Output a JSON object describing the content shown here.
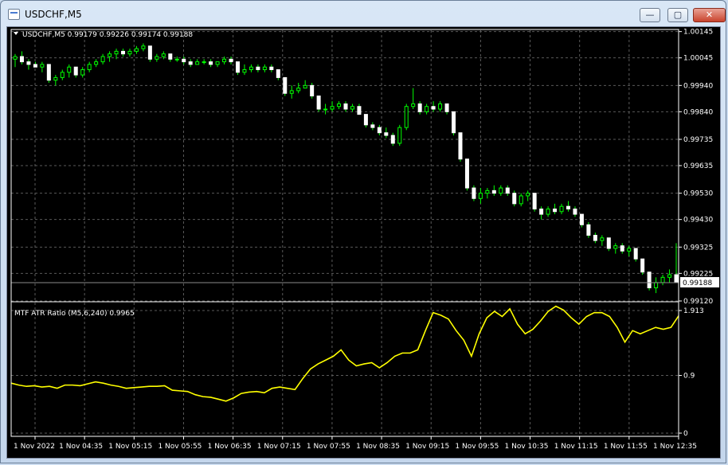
{
  "window": {
    "title": "USDCHF,M5",
    "buttons": {
      "minimize": "—",
      "maximize": "▢",
      "close": "✕"
    }
  },
  "main_chart": {
    "header": "USDCHF,M5  0.99179 0.99226 0.99174 0.99188",
    "current_price": "0.99188",
    "price_scale": [
      "1.00145",
      "1.00045",
      "0.99940",
      "0.99840",
      "0.99735",
      "0.99635",
      "0.99530",
      "0.99430",
      "0.99325",
      "0.99225",
      "0.99120"
    ]
  },
  "indicator": {
    "label": "MTF ATR Ratio  (M5,6,240) 0.9965",
    "scale": [
      "1.913",
      "0.9",
      "0"
    ]
  },
  "time_axis": [
    "1 Nov 2022",
    "1 Nov 04:35",
    "1 Nov 05:15",
    "1 Nov 05:55",
    "1 Nov 06:35",
    "1 Nov 07:15",
    "1 Nov 07:55",
    "1 Nov 08:35",
    "1 Nov 09:15",
    "1 Nov 09:55",
    "1 Nov 10:35",
    "1 Nov 11:15",
    "1 Nov 11:55",
    "1 Nov 12:35"
  ],
  "colors": {
    "bull": "#00ff00",
    "bear": "#ffffff",
    "grid": "#5a5a5a",
    "indicator_line": "#ffff00",
    "axis_text": "#ffffff"
  },
  "chart_data": [
    {
      "type": "candlestick",
      "title": "USDCHF,M5",
      "ylim": [
        0.9912,
        1.0015
      ],
      "ohlc": [
        [
          1.0004,
          1.0006,
          1.0001,
          1.0005
        ],
        [
          1.0005,
          1.0007,
          1.0002,
          1.0003
        ],
        [
          1.0003,
          1.0004,
          1.0,
          1.0002
        ],
        [
          1.0002,
          1.0003,
          1.0001,
          1.0001
        ],
        [
          1.0001,
          1.0003,
          0.9999,
          1.0002
        ],
        [
          1.0002,
          1.0002,
          0.9995,
          0.9996
        ],
        [
          0.9996,
          0.9998,
          0.9994,
          0.9997
        ],
        [
          0.9997,
          1.0,
          0.9996,
          0.9999
        ],
        [
          0.9999,
          1.0002,
          0.9997,
          1.0001
        ],
        [
          1.0001,
          1.0001,
          0.9997,
          0.9998
        ],
        [
          0.9998,
          1.0001,
          0.9997,
          1.0
        ],
        [
          1.0,
          1.0003,
          0.9999,
          1.0002
        ],
        [
          1.0002,
          1.0004,
          1.0001,
          1.0003
        ],
        [
          1.0003,
          1.0006,
          1.0002,
          1.0005
        ],
        [
          1.0005,
          1.0007,
          1.0003,
          1.0006
        ],
        [
          1.0006,
          1.0008,
          1.0004,
          1.0007
        ],
        [
          1.0007,
          1.0008,
          1.0005,
          1.0006
        ],
        [
          1.0006,
          1.0008,
          1.0005,
          1.0007
        ],
        [
          1.0007,
          1.0009,
          1.0006,
          1.0008
        ],
        [
          1.0008,
          1.001,
          1.0007,
          1.0009
        ],
        [
          1.0009,
          1.0009,
          1.0003,
          1.0004
        ],
        [
          1.0004,
          1.0006,
          1.0003,
          1.0005
        ],
        [
          1.0005,
          1.0007,
          1.0004,
          1.0006
        ],
        [
          1.0006,
          1.0006,
          1.0003,
          1.0004
        ],
        [
          1.0004,
          1.0005,
          1.0003,
          1.0004
        ],
        [
          1.0004,
          1.0005,
          1.0002,
          1.0003
        ],
        [
          1.0003,
          1.0004,
          1.0001,
          1.0002
        ],
        [
          1.0002,
          1.0004,
          1.0002,
          1.0003
        ],
        [
          1.0003,
          1.0004,
          1.0002,
          1.0003
        ],
        [
          1.0003,
          1.0004,
          1.0001,
          1.0002
        ],
        [
          1.0002,
          1.0003,
          1.0001,
          1.0003
        ],
        [
          1.0003,
          1.0005,
          1.0002,
          1.0004
        ],
        [
          1.0004,
          1.0005,
          1.0002,
          1.0003
        ],
        [
          1.0003,
          1.0003,
          0.9998,
          0.9999
        ],
        [
          0.9999,
          1.0002,
          0.9998,
          1.0
        ],
        [
          1.0,
          1.0002,
          0.9999,
          1.0001
        ],
        [
          1.0001,
          1.0002,
          0.9999,
          1.0
        ],
        [
          1.0,
          1.0002,
          0.9999,
          1.0001
        ],
        [
          1.0001,
          1.0002,
          0.9999,
          1.0
        ],
        [
          1.0,
          1.0,
          0.9996,
          0.9997
        ],
        [
          0.9997,
          0.9997,
          0.999,
          0.9991
        ],
        [
          0.9991,
          0.9994,
          0.9989,
          0.9992
        ],
        [
          0.9992,
          0.9995,
          0.9991,
          0.9993
        ],
        [
          0.9993,
          0.9996,
          0.9993,
          0.9994
        ],
        [
          0.9994,
          0.9995,
          0.9989,
          0.999
        ],
        [
          0.999,
          0.999,
          0.9984,
          0.9985
        ],
        [
          0.9985,
          0.9987,
          0.9983,
          0.9985
        ],
        [
          0.9985,
          0.9988,
          0.9984,
          0.9986
        ],
        [
          0.9986,
          0.9988,
          0.9985,
          0.9987
        ],
        [
          0.9987,
          0.9988,
          0.9984,
          0.9985
        ],
        [
          0.9985,
          0.9987,
          0.9984,
          0.9986
        ],
        [
          0.9986,
          0.9987,
          0.9983,
          0.9983
        ],
        [
          0.9983,
          0.9983,
          0.9978,
          0.9979
        ],
        [
          0.9979,
          0.998,
          0.9977,
          0.9978
        ],
        [
          0.9978,
          0.9979,
          0.9975,
          0.9976
        ],
        [
          0.9976,
          0.9978,
          0.9974,
          0.9975
        ],
        [
          0.9975,
          0.9976,
          0.9971,
          0.9972
        ],
        [
          0.9972,
          0.9979,
          0.9971,
          0.9978
        ],
        [
          0.9978,
          0.9987,
          0.9977,
          0.9986
        ],
        [
          0.9986,
          0.9993,
          0.9985,
          0.9987
        ],
        [
          0.9987,
          0.9988,
          0.9983,
          0.9984
        ],
        [
          0.9984,
          0.9987,
          0.9983,
          0.9986
        ],
        [
          0.9986,
          0.9988,
          0.9984,
          0.9985
        ],
        [
          0.9985,
          0.9988,
          0.9984,
          0.9987
        ],
        [
          0.9987,
          0.9987,
          0.9983,
          0.9984
        ],
        [
          0.9984,
          0.9984,
          0.9975,
          0.9976
        ],
        [
          0.9976,
          0.9976,
          0.9965,
          0.9966
        ],
        [
          0.9966,
          0.9966,
          0.9954,
          0.9955
        ],
        [
          0.9955,
          0.9956,
          0.995,
          0.9951
        ],
        [
          0.9951,
          0.9955,
          0.9949,
          0.9953
        ],
        [
          0.9953,
          0.9955,
          0.9951,
          0.9954
        ],
        [
          0.9954,
          0.9956,
          0.9952,
          0.9953
        ],
        [
          0.9953,
          0.9956,
          0.9952,
          0.9955
        ],
        [
          0.9955,
          0.9956,
          0.9952,
          0.9953
        ],
        [
          0.9953,
          0.9954,
          0.9948,
          0.9949
        ],
        [
          0.9949,
          0.9953,
          0.9948,
          0.9952
        ],
        [
          0.9952,
          0.9954,
          0.995,
          0.9953
        ],
        [
          0.9953,
          0.9953,
          0.9946,
          0.9947
        ],
        [
          0.9947,
          0.9948,
          0.9943,
          0.9945
        ],
        [
          0.9945,
          0.9948,
          0.9944,
          0.9947
        ],
        [
          0.9947,
          0.9949,
          0.9945,
          0.9946
        ],
        [
          0.9946,
          0.9949,
          0.9945,
          0.9948
        ],
        [
          0.9948,
          0.995,
          0.9946,
          0.9947
        ],
        [
          0.9947,
          0.9948,
          0.9944,
          0.9945
        ],
        [
          0.9945,
          0.9945,
          0.994,
          0.9941
        ],
        [
          0.9941,
          0.9942,
          0.9936,
          0.9937
        ],
        [
          0.9937,
          0.9938,
          0.9934,
          0.9935
        ],
        [
          0.9935,
          0.9937,
          0.9933,
          0.9936
        ],
        [
          0.9936,
          0.9936,
          0.9931,
          0.9932
        ],
        [
          0.9932,
          0.9934,
          0.993,
          0.9933
        ],
        [
          0.9933,
          0.9934,
          0.993,
          0.9931
        ],
        [
          0.9931,
          0.9933,
          0.9929,
          0.9932
        ],
        [
          0.9932,
          0.9932,
          0.9927,
          0.9928
        ],
        [
          0.9928,
          0.9928,
          0.9922,
          0.9923
        ],
        [
          0.9923,
          0.9923,
          0.9916,
          0.9917
        ],
        [
          0.9917,
          0.9921,
          0.9915,
          0.9919
        ],
        [
          0.9919,
          0.9922,
          0.9918,
          0.9921
        ],
        [
          0.9921,
          0.9924,
          0.9919,
          0.9922
        ],
        [
          0.9922,
          0.9934,
          0.9921,
          0.9919
        ]
      ]
    },
    {
      "type": "line",
      "title": "MTF ATR Ratio  (M5,6,240) 0.9965",
      "ylim": [
        0,
        1.913
      ],
      "series": [
        {
          "values": [
            0.78,
            0.75,
            0.73,
            0.74,
            0.72,
            0.73,
            0.7,
            0.75,
            0.75,
            0.74,
            0.77,
            0.8,
            0.78,
            0.75,
            0.73,
            0.7,
            0.71,
            0.72,
            0.73,
            0.73,
            0.74,
            0.67,
            0.66,
            0.65,
            0.6,
            0.57,
            0.56,
            0.53,
            0.5,
            0.55,
            0.62,
            0.64,
            0.65,
            0.63,
            0.7,
            0.72,
            0.7,
            0.68,
            0.85,
            1.0,
            1.08,
            1.14,
            1.2,
            1.3,
            1.14,
            1.05,
            1.08,
            1.1,
            1.02,
            1.1,
            1.2,
            1.25,
            1.25,
            1.3,
            1.6,
            1.88,
            1.84,
            1.78,
            1.6,
            1.45,
            1.2,
            1.55,
            1.8,
            1.9,
            1.82,
            1.94,
            1.7,
            1.55,
            1.62,
            1.75,
            1.9,
            1.98,
            1.92,
            1.8,
            1.7,
            1.82,
            1.88,
            1.88,
            1.82,
            1.65,
            1.42,
            1.6,
            1.55,
            1.6,
            1.65,
            1.62,
            1.65,
            1.83
          ]
        }
      ]
    }
  ]
}
